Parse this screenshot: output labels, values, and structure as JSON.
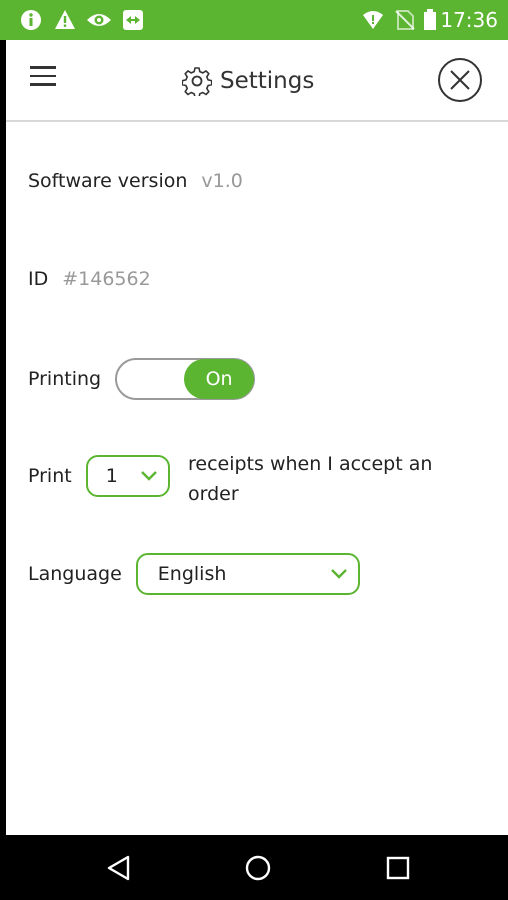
{
  "status_bar": {
    "time": "17:36",
    "icons": [
      "info-icon",
      "warning-icon",
      "eye-icon",
      "remote-icon",
      "wifi-icon",
      "no-sim-icon",
      "battery-icon"
    ],
    "background": "#5cb531"
  },
  "header": {
    "title": "Settings",
    "menu_icon": "hamburger-icon",
    "title_icon": "gear-icon",
    "close_icon": "close-icon"
  },
  "settings": {
    "software_version_label": "Software version",
    "software_version_value": "v1.0",
    "id_label": "ID",
    "id_value": "#146562",
    "printing_label": "Printing",
    "printing_toggle": "On",
    "print_label": "Print",
    "print_count": "1",
    "print_tail": "receipts when I accept an order",
    "language_label": "Language",
    "language_value": "English"
  },
  "nav_bar": {
    "icons": [
      "back-icon",
      "home-icon",
      "recents-icon"
    ]
  },
  "colors": {
    "accent": "#5cb531",
    "muted_text": "#999999",
    "text": "#222222"
  }
}
